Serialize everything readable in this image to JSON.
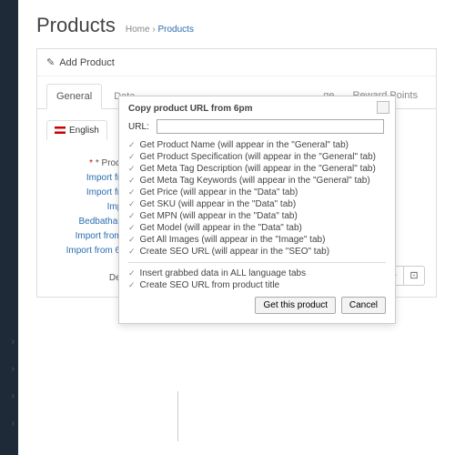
{
  "page": {
    "title": "Products"
  },
  "breadcrumb": {
    "home": "Home",
    "sep": "›",
    "current": "Products"
  },
  "panel": {
    "heading": "Add Product"
  },
  "tabs": {
    "general": "General",
    "data": "Data",
    "reward": "Reward Points",
    "hidden": "ge"
  },
  "lang": {
    "english": "English"
  },
  "labels": {
    "product": "* Product",
    "import1": "Import from",
    "import2": "Import from",
    "import3": "Import",
    "bedbath": "Bedbathandb",
    "amazon": "Import from Ar",
    "sixpm": "Import from 6pm",
    "descr": "Descr"
  },
  "modal": {
    "title": "Copy product URL from 6pm",
    "url_label": "URL:",
    "checks": [
      "Get Product Name (will appear in the \"General\" tab)",
      "Get Product Specification (will appear in the \"General\" tab)",
      "Get Meta Tag Description (will appear in the \"General\" tab)",
      "Get Meta Tag Keywords (will appear in the \"General\" tab)",
      "Get Price (will appear in the \"Data\" tab)",
      "Get SKU (will appear in the \"Data\" tab)",
      "Get MPN (will appear in the \"Data\" tab)",
      "Get Model (will appear in the \"Data\" tab)",
      "Get All Images (will appear in the \"Image\" tab)",
      "Create SEO URL (will appear in the \"SEO\" tab)"
    ],
    "checks2": [
      "Insert grabbed data in ALL language tabs",
      "Create SEO URL from product title"
    ],
    "btn_get": "Get this product",
    "btn_cancel": "Cancel"
  },
  "toolbar": {
    "i1": "⊞",
    "i2": "▤",
    "i3": "—",
    "i4": "⋮⋮",
    "i5": "℮",
    "i6": "⊡"
  }
}
